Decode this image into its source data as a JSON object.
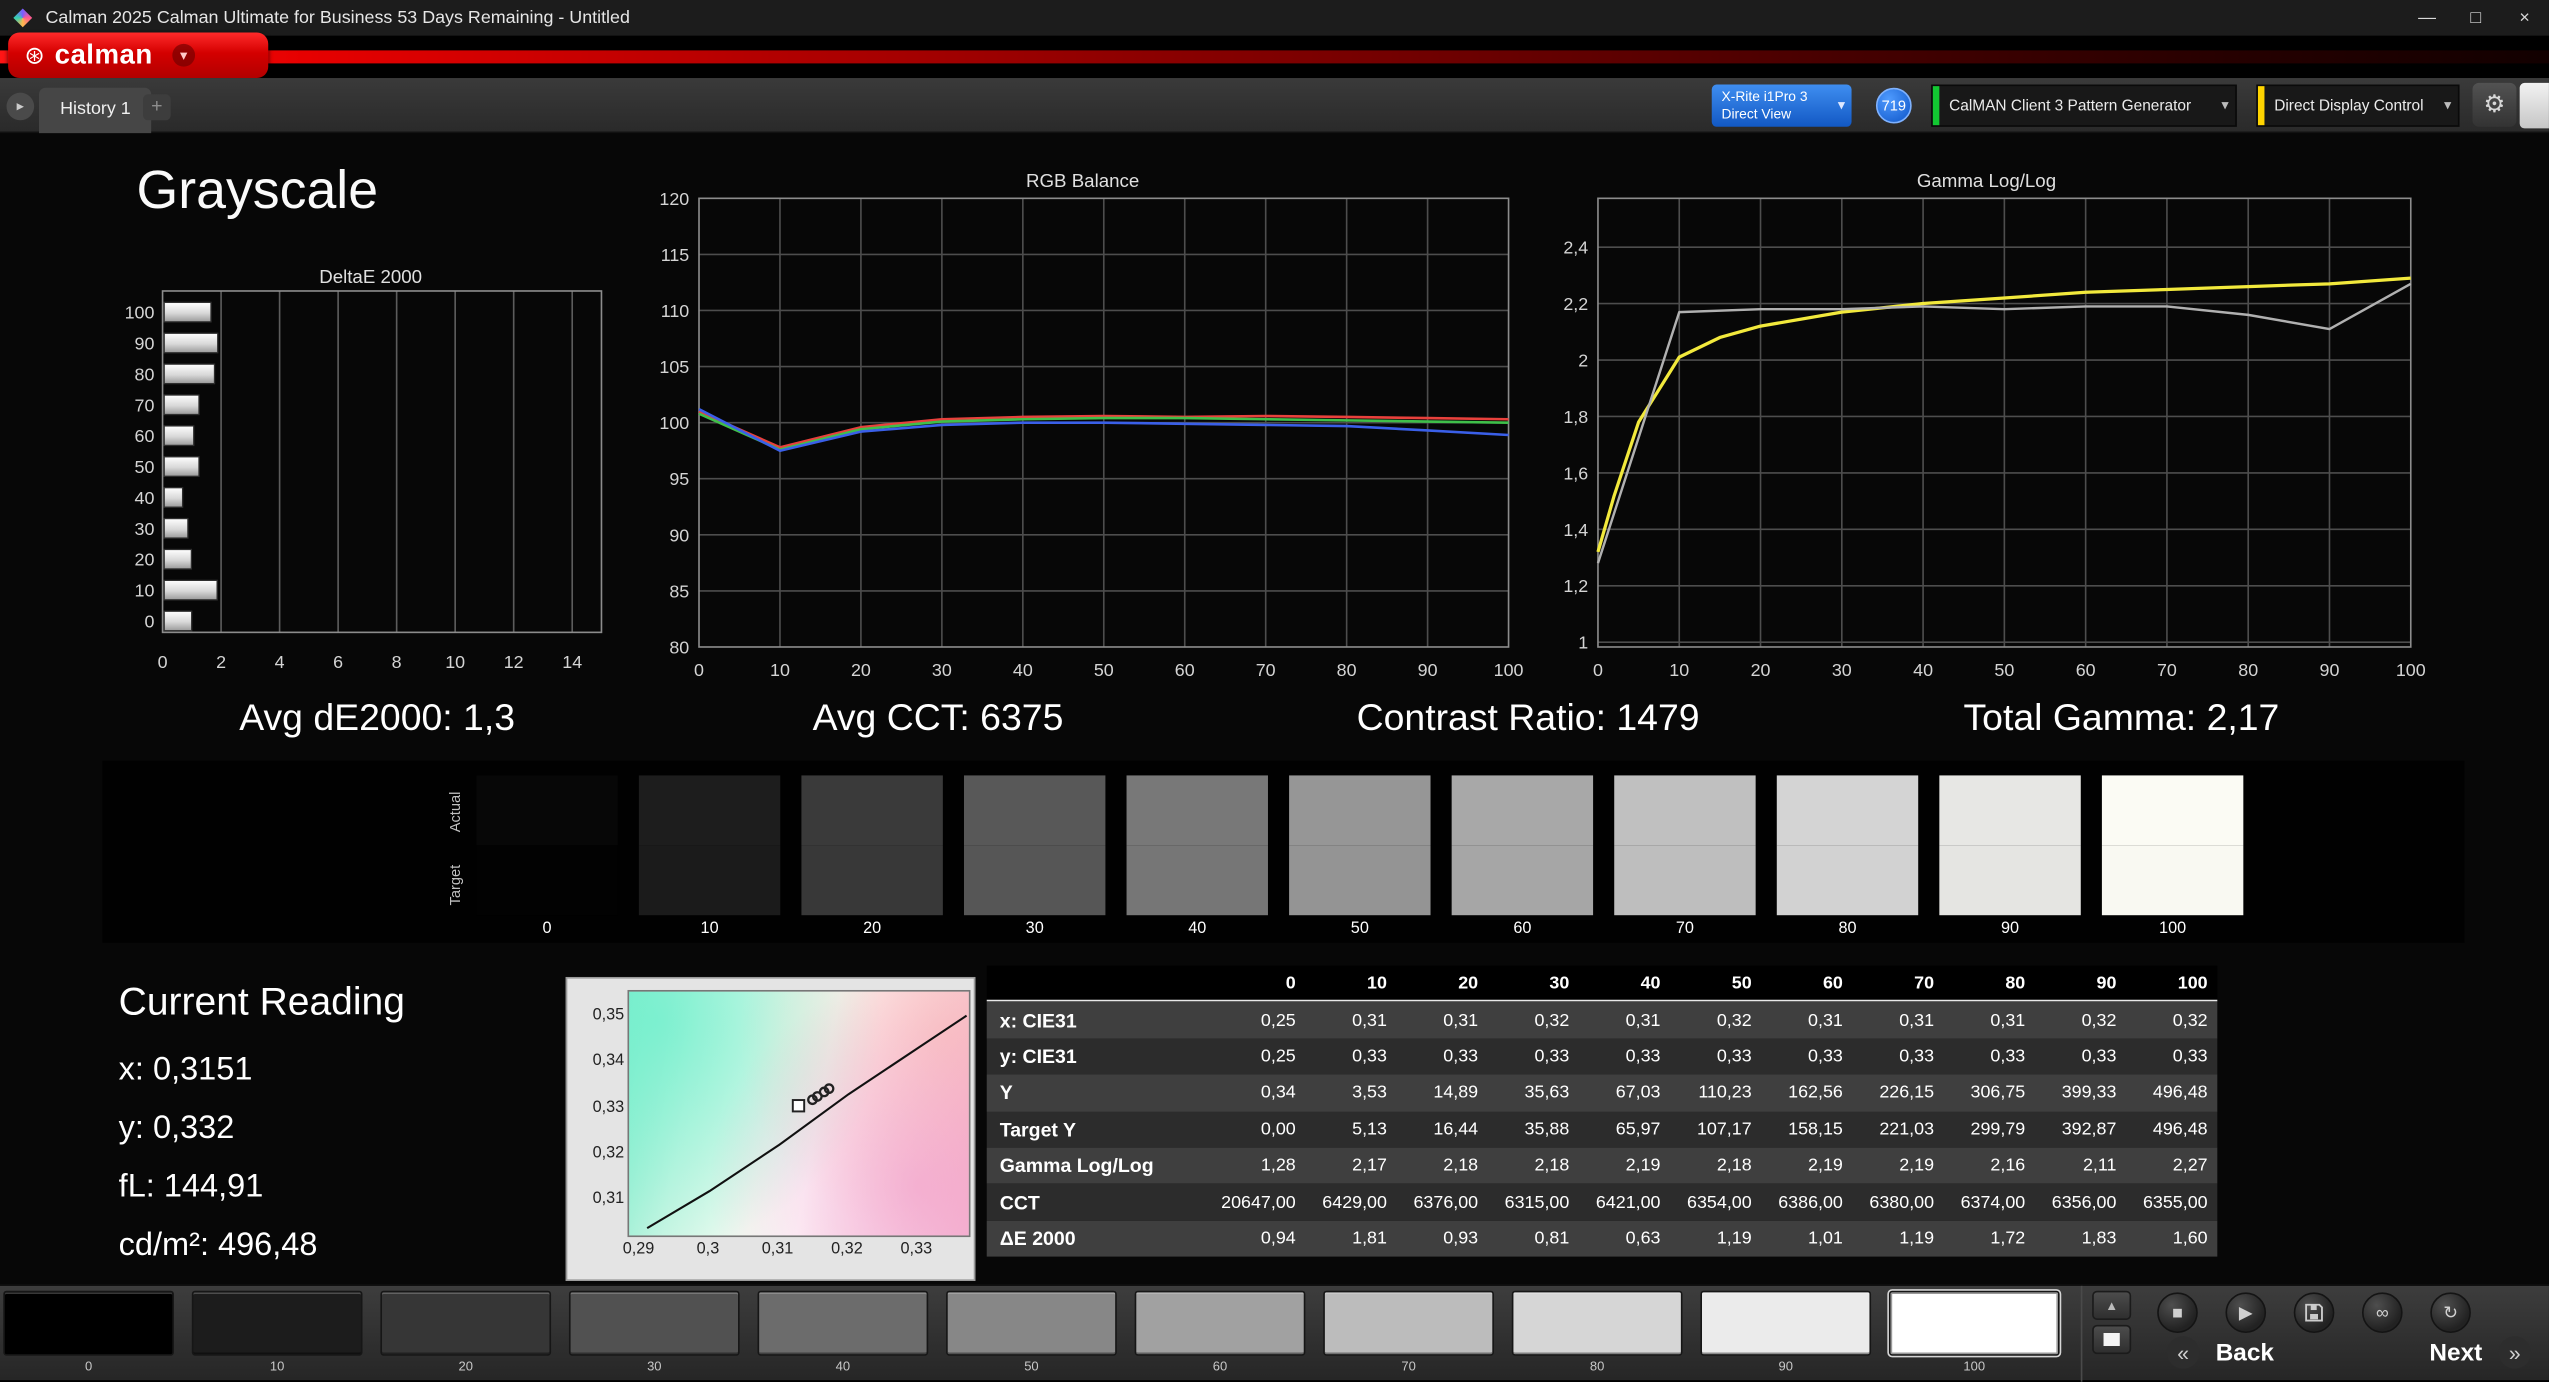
{
  "window": {
    "title": "Calman 2025 Calman Ultimate for Business 53 Days Remaining  - Untitled",
    "minimize": "—",
    "maximize": "□",
    "close": "×"
  },
  "brand": {
    "logo_icon": "⊛",
    "logo_text": "calman",
    "dropdown_arrow": "▾"
  },
  "toolbar": {
    "nav_arrow": "▸",
    "history_tab": "History 1",
    "add_tab": "+",
    "meter_line1": "X-Rite i1Pro 3",
    "meter_line2": "Direct View",
    "meter_arrow": "▾",
    "badge": "719",
    "pattern_label": "CalMAN Client 3 Pattern Generator",
    "pattern_arrow": "▾",
    "display_label": "Direct Display Control",
    "display_arrow": "▾",
    "gear": "⚙"
  },
  "page": {
    "title": "Grayscale"
  },
  "summary": {
    "avg_de": "Avg dE2000: 1,3",
    "avg_cct": "Avg CCT: 6375",
    "contrast": "Contrast Ratio: 1479",
    "total_gamma": "Total Gamma: 2,17"
  },
  "chart_data": [
    {
      "name": "deltae2000",
      "type": "bar",
      "orientation": "horizontal",
      "title": "DeltaE 2000",
      "categories": [
        100,
        90,
        80,
        70,
        60,
        50,
        40,
        30,
        20,
        10,
        0
      ],
      "values": [
        1.6,
        1.83,
        1.72,
        1.19,
        1.01,
        1.19,
        0.63,
        0.81,
        0.93,
        1.81,
        0.94
      ],
      "xlim": [
        0,
        15
      ],
      "xticks": [
        0,
        2,
        4,
        6,
        8,
        10,
        12,
        14
      ],
      "grid": "vertical"
    },
    {
      "name": "rgb_balance",
      "type": "line",
      "title": "RGB Balance",
      "x": [
        0,
        10,
        20,
        30,
        40,
        50,
        60,
        70,
        80,
        90,
        100
      ],
      "xticks": [
        0,
        10,
        20,
        30,
        40,
        50,
        60,
        70,
        80,
        90,
        100
      ],
      "ylim": [
        80,
        120
      ],
      "yticks": [
        80,
        85,
        90,
        95,
        100,
        105,
        110,
        115,
        120
      ],
      "grid": "both",
      "series": [
        {
          "name": "red",
          "color": "#e8413c",
          "width": 1.6,
          "values": [
            101.0,
            97.8,
            99.6,
            100.3,
            100.5,
            100.6,
            100.5,
            100.6,
            100.5,
            100.4,
            100.3
          ]
        },
        {
          "name": "green",
          "color": "#3fbf4a",
          "width": 1.6,
          "values": [
            100.8,
            97.6,
            99.4,
            100.1,
            100.3,
            100.4,
            100.4,
            100.3,
            100.2,
            100.1,
            100.0
          ]
        },
        {
          "name": "blue",
          "color": "#3a5fe8",
          "width": 1.6,
          "values": [
            101.2,
            97.5,
            99.2,
            99.8,
            100.0,
            100.0,
            99.9,
            99.8,
            99.7,
            99.3,
            98.9
          ]
        }
      ]
    },
    {
      "name": "gamma_loglog",
      "type": "line",
      "title": "Gamma Log/Log",
      "xticks": [
        0,
        10,
        20,
        30,
        40,
        50,
        60,
        70,
        80,
        90,
        100
      ],
      "ylim": [
        0.983,
        2.573
      ],
      "yticks": [
        2.4,
        2.2,
        2,
        1.8,
        1.6,
        1.4,
        1.2,
        1
      ],
      "ytick_labels": [
        "2,4",
        "2,2",
        "2",
        "1,8",
        "1,6",
        "1,4",
        "1,2",
        "1"
      ],
      "grid": "both",
      "series": [
        {
          "name": "target",
          "color": "#f2e93c",
          "width": 2,
          "x": [
            0,
            2,
            5,
            10,
            15,
            20,
            30,
            40,
            50,
            60,
            70,
            80,
            90,
            100
          ],
          "values": [
            1.32,
            1.52,
            1.78,
            2.01,
            2.08,
            2.12,
            2.17,
            2.2,
            2.22,
            2.24,
            2.25,
            2.26,
            2.27,
            2.29
          ]
        },
        {
          "name": "measured",
          "color": "#b0b0b0",
          "width": 1.5,
          "x": [
            0,
            10,
            20,
            30,
            40,
            50,
            60,
            70,
            80,
            90,
            100
          ],
          "values": [
            1.28,
            2.17,
            2.18,
            2.18,
            2.19,
            2.18,
            2.19,
            2.19,
            2.16,
            2.11,
            2.27
          ]
        }
      ]
    }
  ],
  "swatches": {
    "row_label_actual": "Actual",
    "row_label_target": "Target",
    "items": [
      {
        "label": "0",
        "actual": "#070707",
        "target": "#020202"
      },
      {
        "label": "10",
        "actual": "#1d1d1d",
        "target": "#1b1b1b"
      },
      {
        "label": "20",
        "actual": "#3a3a3a",
        "target": "#383838"
      },
      {
        "label": "30",
        "actual": "#585858",
        "target": "#565656"
      },
      {
        "label": "40",
        "actual": "#787878",
        "target": "#767676"
      },
      {
        "label": "50",
        "actual": "#969696",
        "target": "#949494"
      },
      {
        "label": "60",
        "actual": "#a8a8a8",
        "target": "#a6a6a6"
      },
      {
        "label": "70",
        "actual": "#c0c0c0",
        "target": "#bebebe"
      },
      {
        "label": "80",
        "actual": "#d4d4d4",
        "target": "#d2d2d2"
      },
      {
        "label": "90",
        "actual": "#e7e7e4",
        "target": "#e5e5e2"
      },
      {
        "label": "100",
        "actual": "#fbfbf4",
        "target": "#f9f9f2"
      }
    ]
  },
  "current_reading": {
    "title": "Current Reading",
    "x": "x: 0,3151",
    "y": "y: 0,332",
    "fl": "fL: 144,91",
    "cdm2": "cd/m²: 496,48"
  },
  "cie": {
    "xlim": [
      0.2884,
      0.3378
    ],
    "ylim": [
      0.3017,
      0.3552
    ],
    "xticks": [
      "0,29",
      "0,3",
      "0,31",
      "0,32",
      "0,33"
    ],
    "xtick_vals": [
      0.29,
      0.3,
      0.31,
      0.32,
      0.33
    ],
    "yticks": [
      "0,35",
      "0,34",
      "0,33",
      "0,32",
      "0,31"
    ],
    "ytick_vals": [
      0.35,
      0.34,
      0.33,
      0.32,
      0.31
    ],
    "locus": [
      [
        0.291,
        0.304
      ],
      [
        0.3,
        0.312
      ],
      [
        0.31,
        0.322
      ],
      [
        0.32,
        0.333
      ],
      [
        0.33,
        0.343
      ],
      [
        0.337,
        0.35
      ]
    ],
    "points": [
      [
        0.3155,
        0.3325
      ],
      [
        0.3165,
        0.3335
      ],
      [
        0.3172,
        0.3342
      ],
      [
        0.3148,
        0.3318
      ]
    ],
    "square": [
      0.3128,
      0.3305
    ]
  },
  "table": {
    "columns": [
      "0",
      "10",
      "20",
      "30",
      "40",
      "50",
      "60",
      "70",
      "80",
      "90",
      "100"
    ],
    "rows": [
      {
        "label": "x: CIE31",
        "values": [
          "0,25",
          "0,31",
          "0,31",
          "0,32",
          "0,31",
          "0,32",
          "0,31",
          "0,31",
          "0,31",
          "0,32",
          "0,32"
        ]
      },
      {
        "label": "y: CIE31",
        "values": [
          "0,25",
          "0,33",
          "0,33",
          "0,33",
          "0,33",
          "0,33",
          "0,33",
          "0,33",
          "0,33",
          "0,33",
          "0,33"
        ]
      },
      {
        "label": "Y",
        "values": [
          "0,34",
          "3,53",
          "14,89",
          "35,63",
          "67,03",
          "110,23",
          "162,56",
          "226,15",
          "306,75",
          "399,33",
          "496,48"
        ]
      },
      {
        "label": "Target Y",
        "values": [
          "0,00",
          "5,13",
          "16,44",
          "35,88",
          "65,97",
          "107,17",
          "158,15",
          "221,03",
          "299,79",
          "392,87",
          "496,48"
        ]
      },
      {
        "label": "Gamma Log/Log",
        "values": [
          "1,28",
          "2,17",
          "2,18",
          "2,18",
          "2,19",
          "2,18",
          "2,19",
          "2,19",
          "2,16",
          "2,11",
          "2,27"
        ]
      },
      {
        "label": "CCT",
        "values": [
          "20647,00",
          "6429,00",
          "6376,00",
          "6315,00",
          "6421,00",
          "6354,00",
          "6386,00",
          "6380,00",
          "6374,00",
          "6356,00",
          "6355,00"
        ]
      },
      {
        "label": "ΔE 2000",
        "values": [
          "0,94",
          "1,81",
          "0,93",
          "0,81",
          "0,63",
          "1,19",
          "1,01",
          "1,19",
          "1,72",
          "1,83",
          "1,60"
        ]
      }
    ]
  },
  "bottom": {
    "patches": [
      {
        "label": "0",
        "color": "#000000"
      },
      {
        "label": "10",
        "color": "#1c1c1c"
      },
      {
        "label": "20",
        "color": "#363636"
      },
      {
        "label": "30",
        "color": "#515151"
      },
      {
        "label": "40",
        "color": "#6c6c6c"
      },
      {
        "label": "50",
        "color": "#878787"
      },
      {
        "label": "60",
        "color": "#a1a1a1"
      },
      {
        "label": "70",
        "color": "#bcbcbc"
      },
      {
        "label": "80",
        "color": "#d6d6d6"
      },
      {
        "label": "90",
        "color": "#ebebeb"
      },
      {
        "label": "100",
        "color": "#ffffff",
        "selected": true
      }
    ],
    "controls": {
      "collapse": "▲",
      "stop": "■",
      "play": "▶",
      "link": "∞",
      "sync": "↻",
      "back_arrow": "«",
      "back": "Back",
      "next": "Next",
      "next_arrow": "»"
    }
  }
}
